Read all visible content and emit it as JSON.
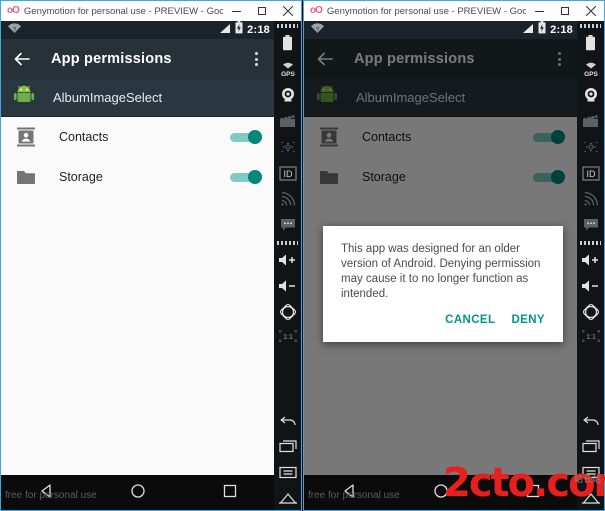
{
  "window_title": "Genymotion for personal use - PREVIEW - Google N...",
  "window_buttons": {
    "minimize": "–",
    "maximize": "□",
    "close": "✕"
  },
  "statusbar": {
    "wifi_icon": "wifi-question-icon",
    "signal_icon": "signal-icon",
    "battery_icon": "battery-charging-icon",
    "time": "2:18"
  },
  "appbar": {
    "back_icon": "back-arrow-icon",
    "title": "App permissions",
    "overflow_icon": "overflow-menu-icon"
  },
  "app_header": {
    "icon": "android-robot-icon",
    "name": "AlbumImageSelect"
  },
  "permissions": [
    {
      "icon": "contacts-icon",
      "label": "Contacts",
      "enabled": true
    },
    {
      "icon": "folder-icon",
      "label": "Storage",
      "enabled": true
    }
  ],
  "dialog": {
    "message": "This app was designed for an older version of Android. Denying permission may cause it to no longer function as intended.",
    "cancel_label": "CANCEL",
    "deny_label": "DENY"
  },
  "navbar": {
    "back": "nav-back-icon",
    "home": "nav-home-icon",
    "recents": "nav-recents-icon"
  },
  "genymotion_toolbar": [
    "battery-icon",
    "gps-icon",
    "camera-icon",
    "video-icon",
    "joystick-icon",
    "id-icon",
    "network-icon",
    "sms-icon",
    "volume-up-icon",
    "volume-down-icon",
    "rotate-icon",
    "pixel-icon"
  ],
  "genymotion_toolbar_bottom": [
    "back-icon",
    "recents-icon",
    "menu-icon",
    "home-icon"
  ],
  "watermarks": {
    "free": "free for personal use",
    "site": "2cto",
    "site_tld": ".com",
    "site_cn": "站长站"
  },
  "colors": {
    "accent": "#009688",
    "toggle_on": "#00897b",
    "appbar": "#263238",
    "brand_red": "#e8201d"
  }
}
